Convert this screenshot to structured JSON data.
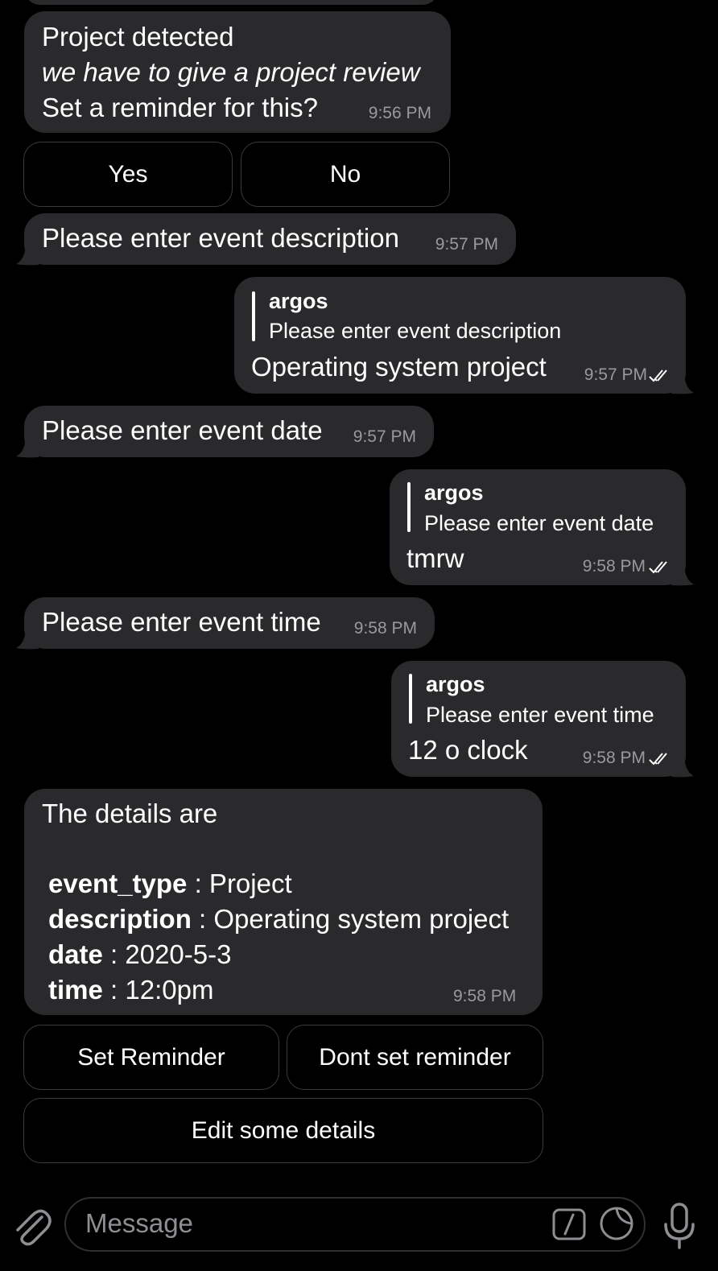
{
  "messages": {
    "m1": {
      "line1": "Project detected",
      "line2": "we have to give a project review",
      "line3": "Set a reminder for this?",
      "time": "9:56 PM"
    },
    "kb1": {
      "yes": "Yes",
      "no": "No"
    },
    "m2": {
      "text": "Please enter event description",
      "time": "9:57 PM"
    },
    "r1": {
      "quote_name": "argos",
      "quote_text": "Please enter event description",
      "text": "Operating system project",
      "time": "9:57 PM"
    },
    "m3": {
      "text": "Please enter event date",
      "time": "9:57 PM"
    },
    "r2": {
      "quote_name": "argos",
      "quote_text": "Please enter event date",
      "text": "tmrw",
      "time": "9:58 PM"
    },
    "m4": {
      "text": "Please enter event time",
      "time": "9:58 PM"
    },
    "r3": {
      "quote_name": "argos",
      "quote_text": "Please enter event time",
      "text": "12 o clock",
      "time": "9:58 PM"
    },
    "details": {
      "header": "The details are",
      "rows": [
        {
          "key": "event_type",
          "value": " : Project"
        },
        {
          "key": "description",
          "value": " : Operating system project"
        },
        {
          "key": "date",
          "value": " : 2020-5-3"
        },
        {
          "key": "time",
          "value": " : 12:0pm"
        }
      ],
      "time": "9:58 PM"
    },
    "kb2": {
      "set": "Set Reminder",
      "dont": "Dont set reminder",
      "edit": "Edit some details"
    }
  },
  "composer": {
    "placeholder": "Message"
  },
  "icons": [
    "attach-icon",
    "bot-command-icon",
    "sticker-icon",
    "microphone-icon",
    "double-check-icon"
  ]
}
